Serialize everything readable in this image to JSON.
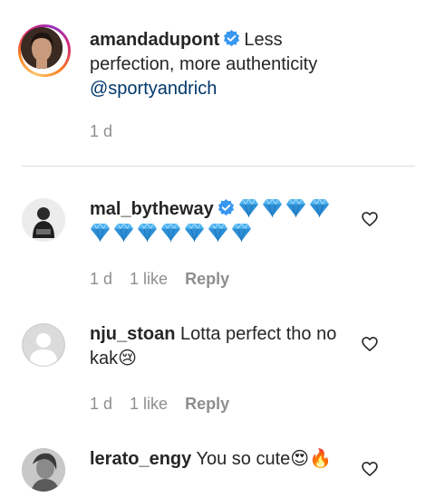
{
  "caption": {
    "username": "amandadupont",
    "text": "Less perfection, more authenticity",
    "mention": "@sportyandrich",
    "time": "1 d"
  },
  "comments": [
    {
      "username": "mal_bytheway",
      "verified": true,
      "text": "💎💎💎💎💎💎💎💎💎💎💎",
      "time": "1 d",
      "likes": "1 like",
      "reply": "Reply"
    },
    {
      "username": "nju_stoan",
      "verified": false,
      "text": "Lotta perfect tho no kak😢",
      "time": "1 d",
      "likes": "1 like",
      "reply": "Reply"
    },
    {
      "username": "lerato_engy",
      "verified": false,
      "text": "You so cute😍🔥"
    }
  ],
  "colors": {
    "verified": "#3897f0",
    "text": "#262626",
    "meta": "#8e8e8e",
    "mention": "#00376b",
    "divider": "#dbdbdb"
  },
  "icons": {
    "like": "heart-outline-icon",
    "verified": "verified-badge-icon"
  }
}
